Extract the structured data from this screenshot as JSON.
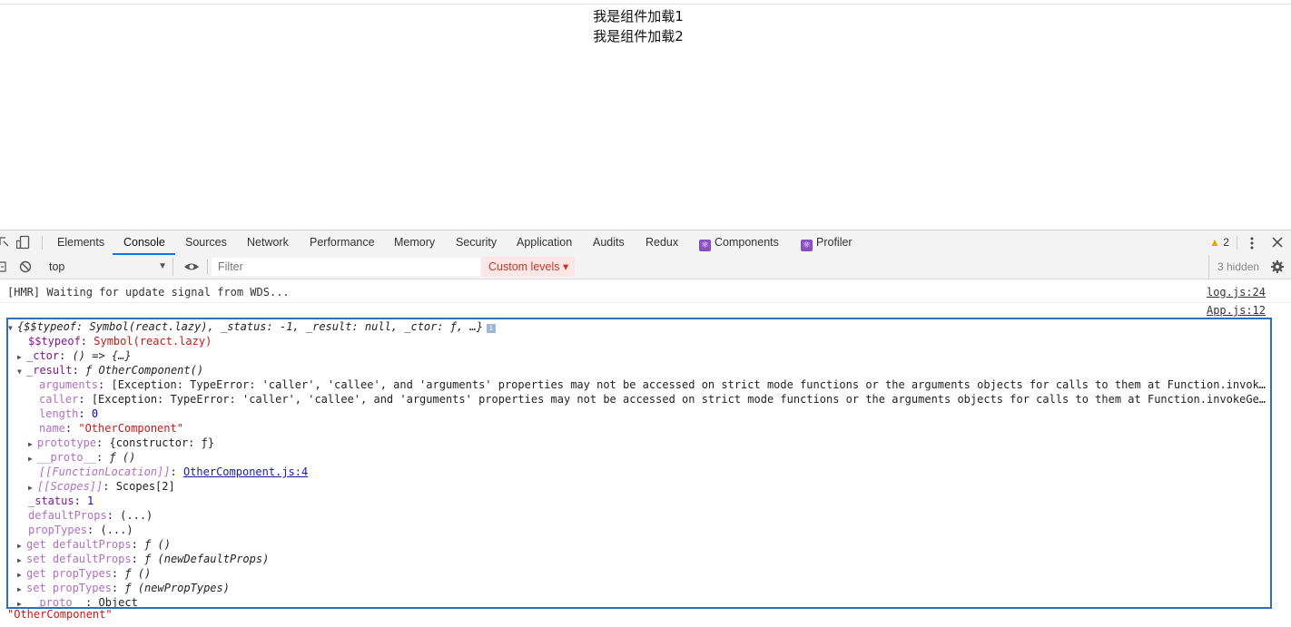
{
  "page": {
    "line1": "我是组件加载1",
    "line2": "我是组件加载2"
  },
  "devtools": {
    "tabs": [
      "Elements",
      "Console",
      "Sources",
      "Network",
      "Performance",
      "Memory",
      "Security",
      "Application",
      "Audits",
      "Redux",
      "Components",
      "Profiler"
    ],
    "active_tab": "Console",
    "warnings_count": "2",
    "icons": {
      "inspect": "inspect-element-icon",
      "device": "device-toolbar-icon",
      "more": "vertical-ellipsis-icon",
      "close": "close-icon",
      "warning": "warning-triangle-icon",
      "react": "react-logo-icon"
    }
  },
  "toolbar": {
    "context": "top",
    "filter_placeholder": "Filter",
    "levels": "Custom levels ▾",
    "hidden": "3 hidden"
  },
  "console": {
    "hmr_message": "[HMR] Waiting for update signal from WDS...",
    "hmr_source": "log.js:24",
    "obj_source": "App.js:12",
    "summary": "{$$typeof: Symbol(react.lazy), _status: -1, _result: null, _ctor: ƒ, …}",
    "typeof_key": "$$typeof",
    "typeof_val": "Symbol(react.lazy)",
    "ctor_key": "_ctor",
    "ctor_val": "() => {…}",
    "result_key": "_result",
    "result_val": "ƒ OtherComponent()",
    "arguments_key": "arguments",
    "arguments_val": "[Exception: TypeError: 'caller', 'callee', and 'arguments' properties may not be accessed on strict mode functions or the arguments objects for calls to them at Function.invokeGetter",
    "caller_key": "caller",
    "caller_val": "[Exception: TypeError: 'caller', 'callee', and 'arguments' properties may not be accessed on strict mode functions or the arguments objects for calls to them at Function.invokeGetter",
    "length_key": "length",
    "length_val": "0",
    "name_key": "name",
    "name_val": "\"OtherComponent\"",
    "prototype_key": "prototype",
    "prototype_val": "{constructor: ƒ}",
    "fproto_key": "__proto__",
    "fproto_val": "ƒ ()",
    "floc_key": "[[FunctionLocation]]",
    "floc_val": "OtherComponent.js:4",
    "scopes_key": "[[Scopes]]",
    "scopes_val": "Scopes[2]",
    "status_key": "_status",
    "status_val": "1",
    "defaultprops_key": "defaultProps",
    "defaultprops_val": "(...)",
    "proptypes_key": "propTypes",
    "proptypes_val": "(...)",
    "get_dp_key": "get defaultProps",
    "get_dp_val": "ƒ ()",
    "set_dp_key": "set defaultProps",
    "set_dp_val": "ƒ (newDefaultProps)",
    "get_pt_key": "get propTypes",
    "get_pt_val": "ƒ ()",
    "set_pt_key": "set propTypes",
    "set_pt_val": "ƒ (newPropTypes)",
    "oproto_key": "__proto__",
    "oproto_val": "Object",
    "result_string": "\"OtherComponent\""
  }
}
